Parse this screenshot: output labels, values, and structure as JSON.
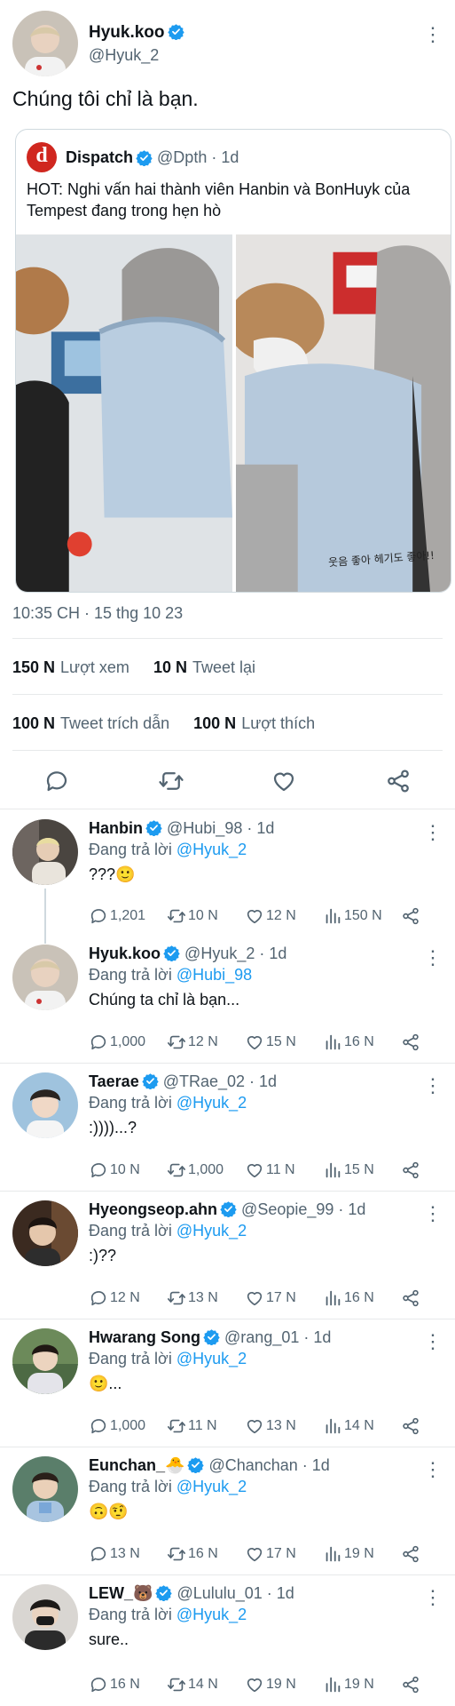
{
  "colors": {
    "accent": "#1d9bf0",
    "text": "#0f1419",
    "muted": "#536471",
    "divider": "#e7e9ea"
  },
  "main": {
    "name": "Hyuk.koo",
    "handle": "@Hyuk_2",
    "text": "Chúng tôi chỉ là bạn.",
    "quote": {
      "logo": "d",
      "name": "Dispatch",
      "handle_time": "@Dpth · 1d",
      "text": "HOT: Nghi vấn hai thành viên Hanbin và BonHuyk của Tempest đang trong hẹn hò",
      "image_caption": "웃음 좋아 헤기도 좋아!!"
    },
    "timestamp": "10:35 CH · 15 thg 10 23",
    "stats": {
      "views_count": "150 N",
      "views_label": "Lượt xem",
      "retweets_count": "10 N",
      "retweets_label": "Tweet lại",
      "quotes_count": "100 N",
      "quotes_label": "Tweet trích dẫn",
      "likes_count": "100 N",
      "likes_label": "Lượt thích"
    },
    "actions": [
      "reply-icon",
      "retweet-icon",
      "like-icon",
      "share-icon"
    ]
  },
  "replies": [
    {
      "name": "Hanbin",
      "handle_time": "@Hubi_98 · 1d",
      "reply_prefix": "Đang trả lời",
      "reply_to": "@Hyuk_2",
      "text": "???🙂",
      "replies": "1,201",
      "retweets": "10 N",
      "likes": "12 N",
      "views": "150 N"
    },
    {
      "name": "Hyuk.koo",
      "handle_time": "@Hyuk_2 · 1d",
      "reply_prefix": "Đang trả lời",
      "reply_to": "@Hubi_98",
      "text": "Chúng ta chỉ là bạn...",
      "replies": "1,000",
      "retweets": "12 N",
      "likes": "15 N",
      "views": "16 N"
    },
    {
      "name": "Taerae",
      "handle_time": "@TRae_02 · 1d",
      "reply_prefix": "Đang trả lời",
      "reply_to": "@Hyuk_2",
      "text": ":))))...?",
      "replies": "10 N",
      "retweets": "1,000",
      "likes": "11 N",
      "views": "15 N"
    },
    {
      "name": "Hyeongseop.ahn",
      "handle_time": "@Seopie_99 · 1d",
      "reply_prefix": "Đang trả lời",
      "reply_to": "@Hyuk_2",
      "text": ":)??",
      "replies": "12 N",
      "retweets": "13 N",
      "likes": "17 N",
      "views": "16 N"
    },
    {
      "name": "Hwarang Song",
      "handle_time": "@rang_01 · 1d",
      "reply_prefix": "Đang trả lời",
      "reply_to": "@Hyuk_2",
      "text": "🙂...",
      "replies": "1,000",
      "retweets": "11 N",
      "likes": "13 N",
      "views": "14 N"
    },
    {
      "name": "Eunchan_🐣",
      "handle_time": "@Chanchan · 1d",
      "reply_prefix": "Đang trả lời",
      "reply_to": "@Hyuk_2",
      "text": "🙃🤨",
      "replies": "13 N",
      "retweets": "16 N",
      "likes": "17 N",
      "views": "19 N"
    },
    {
      "name": "LEW_🐻",
      "handle_time": "@Lululu_01 · 1d",
      "reply_prefix": "Đang trả lời",
      "reply_to": "@Hyuk_2",
      "text": "sure..",
      "replies": "16 N",
      "retweets": "14 N",
      "likes": "19 N",
      "views": "19 N"
    }
  ]
}
